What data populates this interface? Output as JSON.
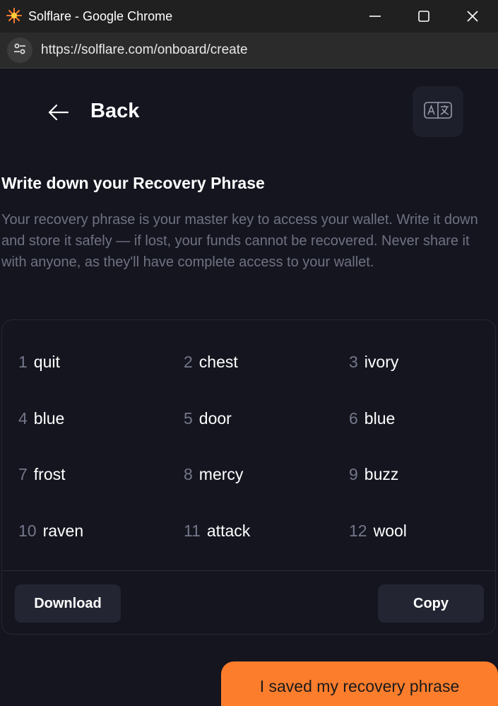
{
  "window": {
    "title": "Solflare - Google Chrome",
    "icons": {
      "app": "solflare-logo-icon",
      "minimize": "minimize-icon",
      "maximize": "maximize-icon",
      "close": "close-icon"
    }
  },
  "addressbar": {
    "url": "https://solflare.com/onboard/create",
    "site_info_icon": "site-settings-icon"
  },
  "header": {
    "back_label": "Back",
    "back_icon": "arrow-left-icon",
    "language_icon": "translate-icon"
  },
  "content": {
    "heading": "Write down your Recovery Phrase",
    "description": "Your recovery phrase is your master key to access your wallet. Write it down and store it safely — if lost, your funds cannot be recovered. Never share it with anyone, as they'll have complete access to your wallet."
  },
  "phrase": {
    "words": [
      {
        "index": "1",
        "word": "quit"
      },
      {
        "index": "2",
        "word": "chest"
      },
      {
        "index": "3",
        "word": "ivory"
      },
      {
        "index": "4",
        "word": "blue"
      },
      {
        "index": "5",
        "word": "door"
      },
      {
        "index": "6",
        "word": "blue"
      },
      {
        "index": "7",
        "word": "frost"
      },
      {
        "index": "8",
        "word": "mercy"
      },
      {
        "index": "9",
        "word": "buzz"
      },
      {
        "index": "10",
        "word": "raven"
      },
      {
        "index": "11",
        "word": "attack"
      },
      {
        "index": "12",
        "word": "wool"
      }
    ],
    "download_label": "Download",
    "copy_label": "Copy"
  },
  "footer": {
    "saved_label": "I saved my recovery phrase"
  },
  "colors": {
    "background": "#14151f",
    "accent": "#fc7d2c",
    "muted_text": "#6f7282",
    "button_bg": "#232533"
  }
}
